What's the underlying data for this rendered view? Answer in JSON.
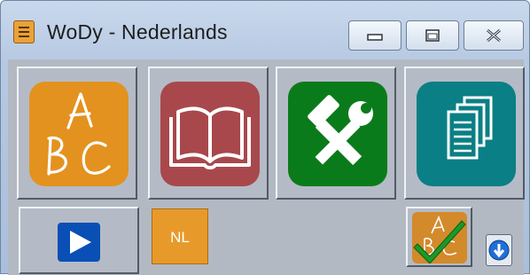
{
  "window": {
    "title": "WoDy - Nederlands",
    "icon": "app-notebook-icon",
    "controls": [
      "minimize-icon",
      "maximize-icon",
      "close-icon"
    ]
  },
  "tiles": [
    {
      "name": "abc-tile",
      "icon": "abc-handwriting-icon",
      "letters": [
        "A",
        "B",
        "C"
      ],
      "color": "#e3921f"
    },
    {
      "name": "dictionary-tile",
      "icon": "open-book-icon",
      "color": "#a8484c"
    },
    {
      "name": "tools-tile",
      "icon": "tools-icon",
      "color": "#0a7b1a"
    },
    {
      "name": "documents-tile",
      "icon": "documents-icon",
      "color": "#0a7f85"
    }
  ],
  "bottom": {
    "play_icon": "play-icon",
    "language_label": "NL",
    "check_icon": "abc-check-icon",
    "info_icon": "info-down-icon"
  },
  "colors": {
    "play_blue": "#0a4fb5",
    "language_orange": "#e79a2a",
    "check_green": "#1a9a2a"
  }
}
